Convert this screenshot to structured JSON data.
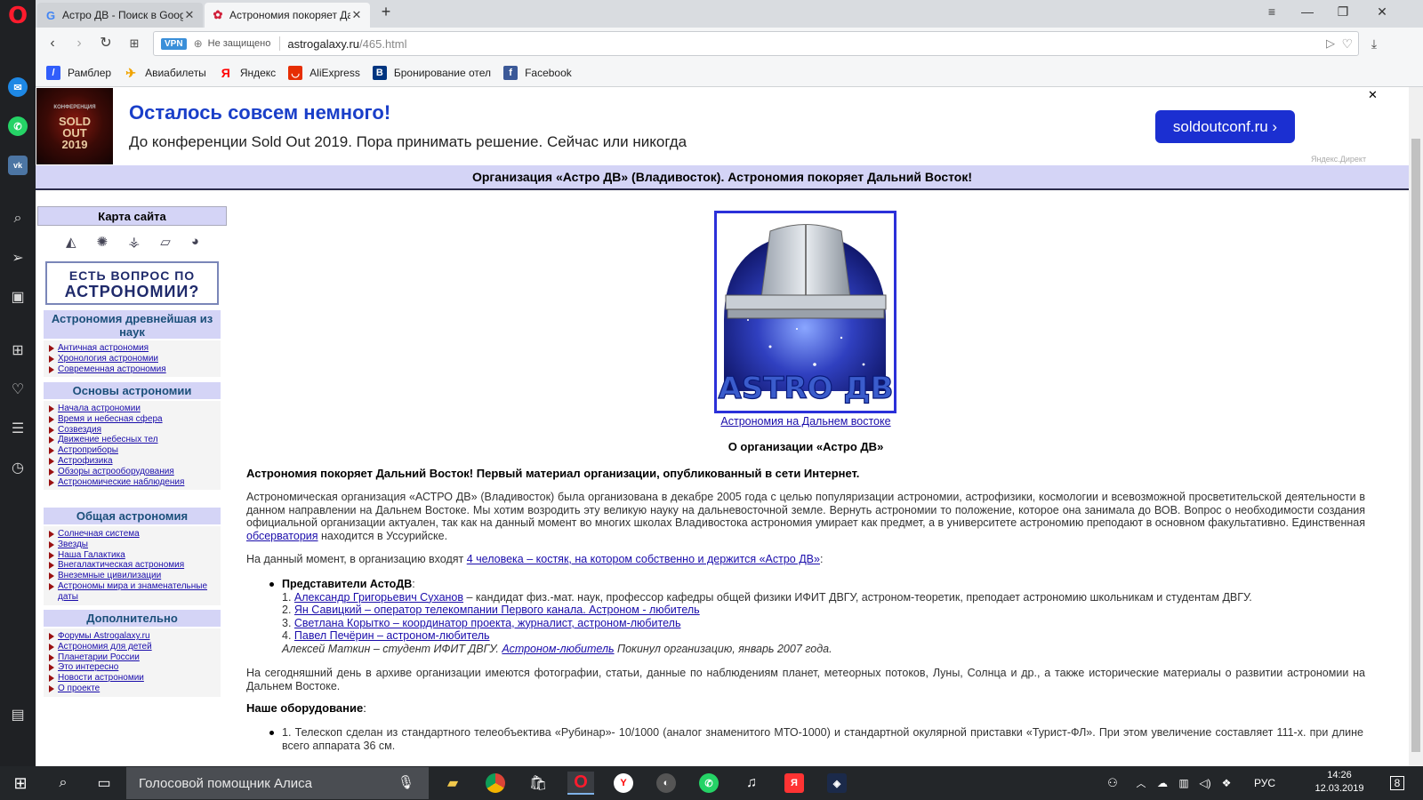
{
  "browser": {
    "tabs": [
      {
        "title": "Астро ДВ - Поиск в Goog",
        "favicon": "google-icon",
        "active": false
      },
      {
        "title": "Астрономия покоряет Да",
        "favicon": "astro-flower-icon",
        "active": true
      }
    ],
    "vpn_label": "VPN",
    "security_text": "Не защищено",
    "url_host": "astrogalaxy.ru",
    "url_path": "/465.html",
    "bookmarks": [
      {
        "label": "Рамблер",
        "icon": "rambler-icon",
        "color": "#315efb"
      },
      {
        "label": "Авиабилеты",
        "icon": "plane-icon",
        "color": "#f0a400"
      },
      {
        "label": "Яндекс",
        "icon": "yandex-icon",
        "color": "#ff0000"
      },
      {
        "label": "AliExpress",
        "icon": "aliexpress-icon",
        "color": "#e62e04"
      },
      {
        "label": "Бронирование отел",
        "icon": "booking-icon",
        "color": "#003580"
      },
      {
        "label": "Facebook",
        "icon": "facebook-icon",
        "color": "#3b5998"
      }
    ]
  },
  "ad": {
    "image_text": {
      "small": "КОНФЕРЕНЦИЯ",
      "line1": "SOLD",
      "line2": "OUT",
      "line3": "2019"
    },
    "title": "Осталось совсем немного!",
    "text": "До конференции Sold Out 2019. Пора принимать решение. Сейчас или никогда",
    "button": "soldoutconf.ru ›",
    "close": "✕",
    "label": "Яндекс.Директ"
  },
  "page": {
    "header": "Организация «Астро ДВ» (Владивосток). Астрономия покоряет Дальний Восток!"
  },
  "sidebar": {
    "map_title": "Карта сайта",
    "ask_banner": {
      "line1": "ЕСТЬ ВОПРОС ПО",
      "line2": "АСТРОНОМИИ?"
    },
    "sections": [
      {
        "title": "Астрономия древнейшая из наук",
        "items": [
          "Античная астрономия",
          "Хронология астрономии",
          "Современная астрономия"
        ]
      },
      {
        "title": "Основы астрономии",
        "items": [
          "Начала астрономии",
          "Время и небесная сфера",
          "Созвездия",
          "Движение небесных тел",
          "Астроприборы",
          "Астрофизика",
          "Обзоры астрооборудования",
          "Астрономические наблюдения"
        ]
      },
      {
        "title": "Общая астрономия",
        "items": [
          "Солнечная система",
          "Звезды",
          "Наша Галактика",
          "Внегалактическая астрономия",
          "Внеземные цивилизации",
          "Астрономы мира и знаменательные даты"
        ]
      },
      {
        "title": "Дополнительно",
        "items": [
          "Форумы Astrogalaxy.ru",
          "Астрономия для детей",
          "Планетарии России",
          "Это интересно",
          "Новости астрономии",
          "О проекте"
        ]
      }
    ]
  },
  "main": {
    "logo_text": "ASTRO ДВ",
    "logo_caption": "Астрономия на Дальнем востоке",
    "about_title": "О организации «Астро ДВ»",
    "intro_bold": "Астрономия покоряет Дальний Восток! Первый материал организации, опубликованный в сети Интернет.",
    "p1_start": "Астрономическая организация «АСТРО ДВ» (Владивосток) была организована в декабре 2005 года с целью популяризации астрономии, астрофизики, космологии и всевозможной просветительской деятельности в данном направлении на Дальнем Востоке. Мы хотим возродить эту великую науку на дальневосточной земле. Вернуть астрономии то положение, которое она занимала до ВОВ. Вопрос о необходимости создания официальной организации актуален, так как на данный момент во многих школах Владивостока астрономия умирает как предмет, а в университете астрономию преподают в основном факультативно. Единственная ",
    "p1_link": "обсерватория",
    "p1_end": " находится в Уссурийске.",
    "p2_start": "На данный момент, в организацию входят ",
    "p2_link": "4 человека – костяк, на котором собственно и держится «Астро ДВ»",
    "p2_end": ":",
    "reps_title": "Представители АстоДВ",
    "reps_colon": ":",
    "reps": [
      {
        "num": "1. ",
        "link": "Александр Григорьевич Суханов",
        "rest": " – кандидат физ.-мат. наук, профессор кафедры общей физики ИФИТ ДВГУ, астроном-теоретик, преподает астрономию школьникам и студентам ДВГУ."
      },
      {
        "num": "2. ",
        "link": "Ян Савицкий – оператор телекомпании Первого канала. Астроном - любитель",
        "rest": ""
      },
      {
        "num": "3. ",
        "link": "Светлана Корытко – координатор проекта, журналист, астроном-любитель",
        "rest": ""
      },
      {
        "num": "4. ",
        "link": "Павел Печёрин – астроном-любитель",
        "rest": ""
      }
    ],
    "former_start": "Алексей Маткин – студент ИФИТ ДВГУ. ",
    "former_link": "Астроном-любитель",
    "former_end": " Покинул организацию, январь 2007 года.",
    "p3": "На сегодняшний день в архиве организации имеются фотографии, статьи, данные по наблюдениям планет, метеорных потоков, Луны, Солнца и др., а также исторические материалы о развитии астрономии на Дальнем Востоке.",
    "equip_title": "Наше оборудование",
    "equip_colon": ":",
    "equip_item": "1. Телескоп сделан из стандартного телеобъектива «Рубинар»- 10/1000 (аналог знаменитого МТО-1000) и стандартной окулярной приставки «Турист-ФЛ». При этом увеличение составляет 111-х. при длине всего аппарата 36 см."
  },
  "taskbar": {
    "search_text": "Голосовой помощник Алиса",
    "lang": "РУС",
    "time": "14:26",
    "date": "12.03.2019",
    "notifications": "8"
  }
}
